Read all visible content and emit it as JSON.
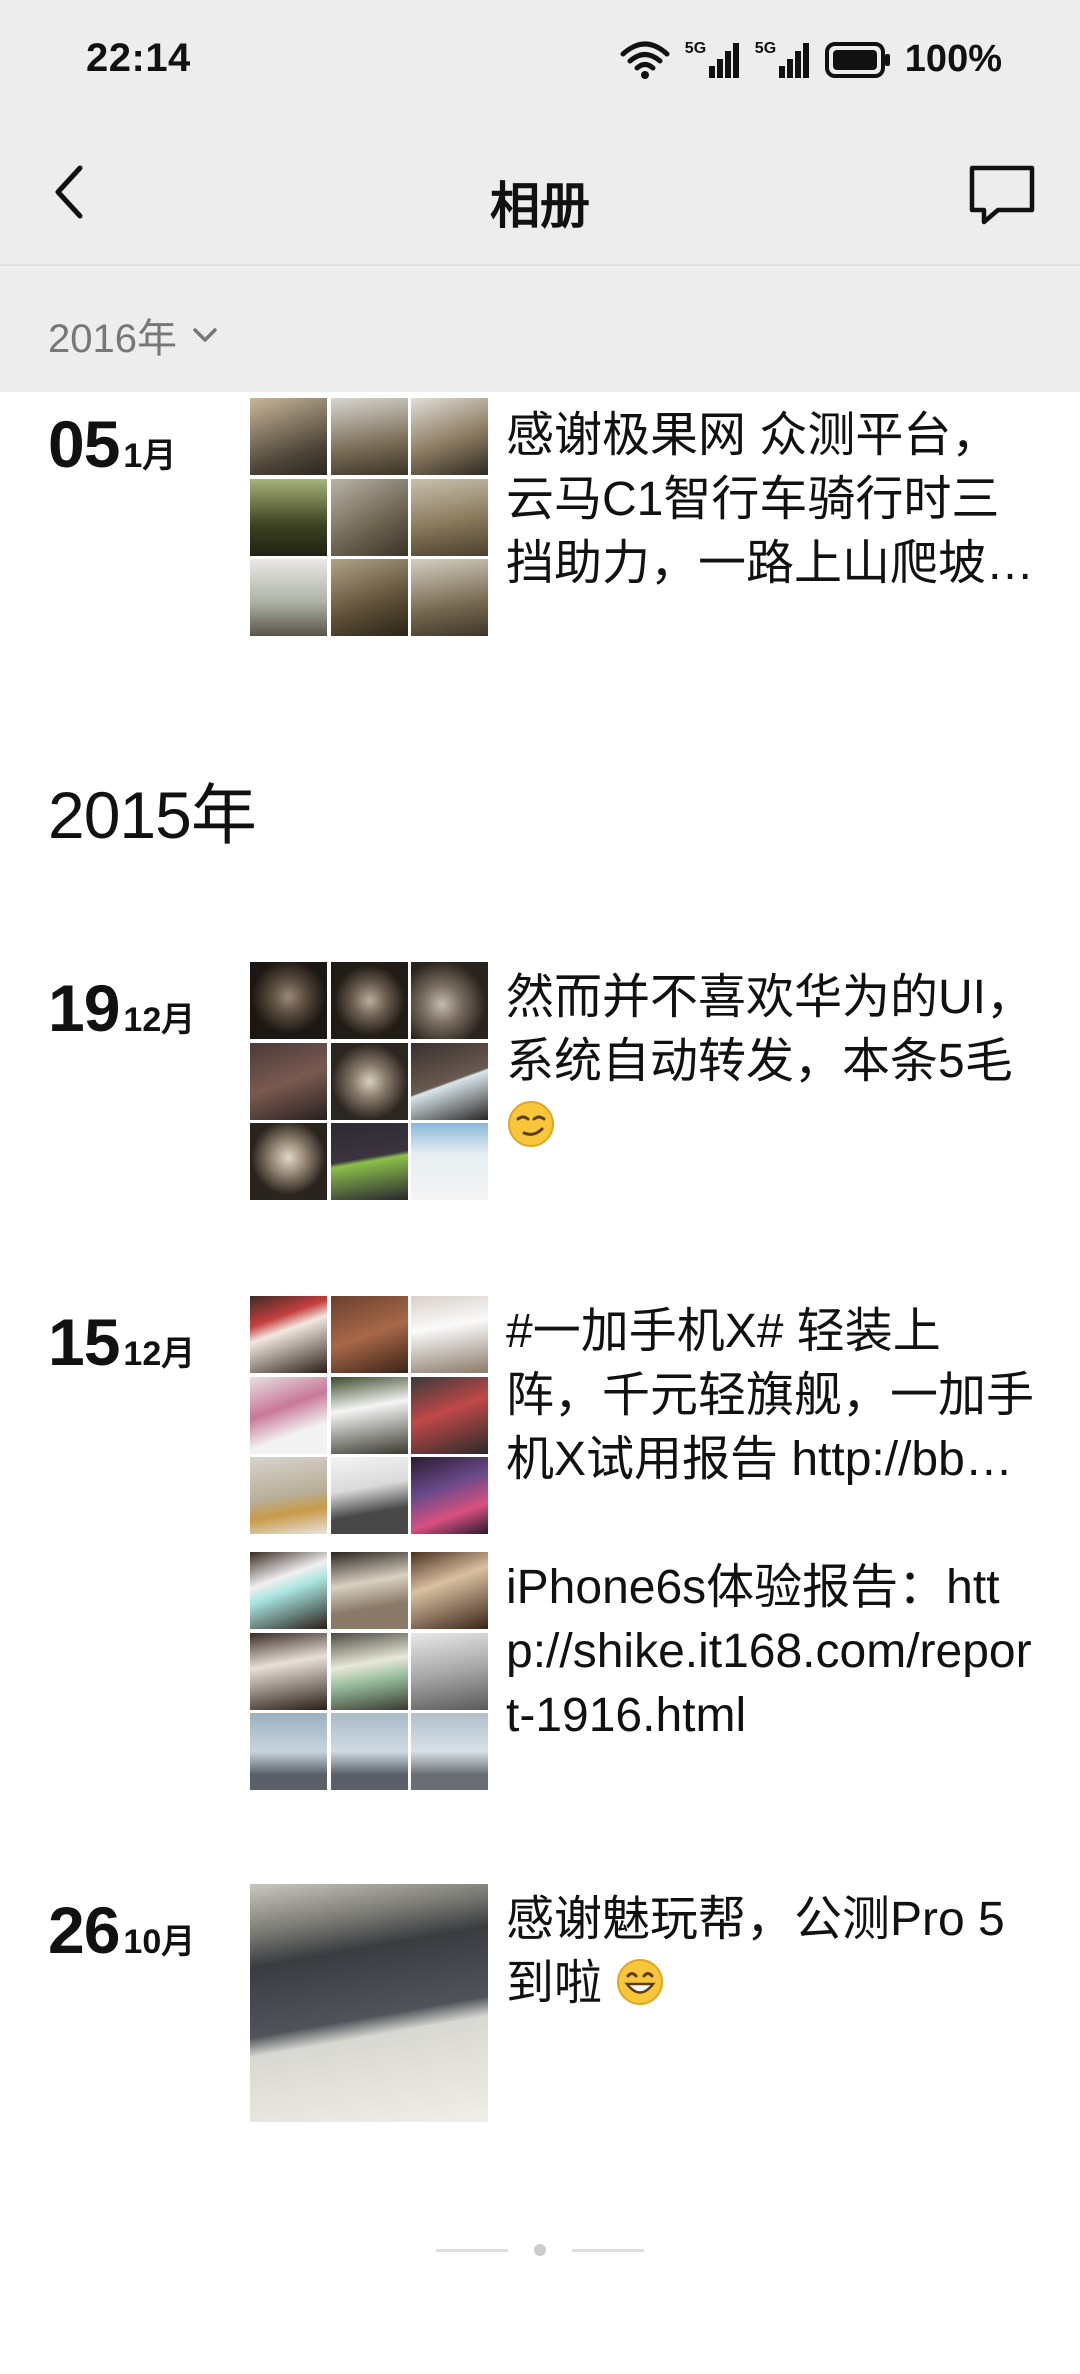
{
  "status_bar": {
    "time": "22:14",
    "network_1": "5G",
    "network_2": "5G",
    "battery_percent": "100%"
  },
  "nav": {
    "title": "相册"
  },
  "filter": {
    "year_label": "2016年"
  },
  "groups": [
    {
      "year": "",
      "entries": [
        {
          "day": "05",
          "month": "1月",
          "posts": [
            {
              "text": "感谢极果网 众测平台，云马C1智行车骑行时三挡助力，一路上山爬坡都很轻松",
              "images": 9
            }
          ]
        }
      ]
    },
    {
      "year": "2015年",
      "entries": [
        {
          "day": "19",
          "month": "12月",
          "posts": [
            {
              "text": "然而并不喜欢华为的UI，系统自动转发，本条5毛",
              "emoji": "smirk-emoji",
              "images": 9
            }
          ]
        },
        {
          "day": "15",
          "month": "12月",
          "posts": [
            {
              "text": "#一加手机X# 轻装上阵，千元轻旗舰，一加手机X试用报告  http://bbs.oneplus.cn",
              "images": 9
            },
            {
              "text": "iPhone6s体验报告：http://shike.it168.com/report-1916.html",
              "images": 9
            }
          ]
        },
        {
          "day": "26",
          "month": "10月",
          "posts": [
            {
              "text": "感谢魅玩帮，公测Pro 5到啦",
              "emoji": "grin-emoji",
              "images": 1
            }
          ]
        }
      ]
    }
  ],
  "colors": {
    "header_bg": "#ededed",
    "text": "#111111",
    "muted": "#777777"
  }
}
